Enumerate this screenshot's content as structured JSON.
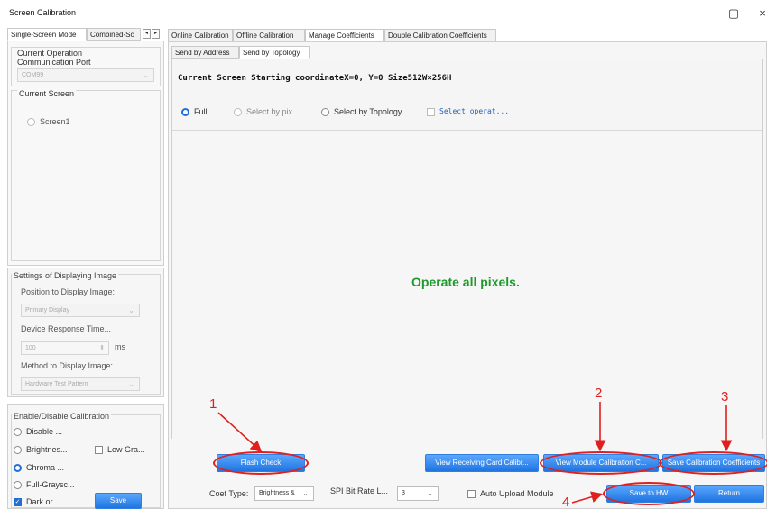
{
  "window": {
    "title": "Screen Calibration",
    "minimize_glyph": "–",
    "maximize_glyph": "▢",
    "close_glyph": "×"
  },
  "left_tabs": {
    "single": "Single-Screen Mode",
    "combined": "Combined-Sc",
    "arrow_left": "◂",
    "arrow_right": "▸"
  },
  "current_operation": {
    "legend": "Current Operation",
    "port_label": "Communication Port",
    "port_value": "COM99"
  },
  "current_screen": {
    "legend": "Current Screen",
    "screen_item": "Screen1"
  },
  "display_settings": {
    "legend": "Settings of Displaying Image",
    "position_label": "Position to Display Image:",
    "position_value": "Primary Display",
    "response_label": "Device Response Time...",
    "response_value": "100",
    "response_unit": "ms",
    "method_label": "Method to Display Image:",
    "method_value": "Hardware Test Pattern"
  },
  "enable_calibration": {
    "legend": "Enable/Disable Calibration",
    "disable": "Disable ...",
    "brightness": "Brightnes...",
    "low_gray": "Low Gra...",
    "chroma": "Chroma ...",
    "full_gray": "Full-Graysc...",
    "dark_or": "Dark or ...",
    "save": "Save"
  },
  "main_tabs": {
    "online": "Online Calibration",
    "offline": "Offline Calibration",
    "manage": "Manage Coefficients",
    "double": "Double Calibration Coefficients"
  },
  "sub_tabs": {
    "by_address": "Send by Address",
    "by_topology": "Send by Topology"
  },
  "screen_info": "Current Screen  Starting coordinateX=0, Y=0   Size512W×256H",
  "mode_options": {
    "full": "Full ...",
    "select_pixel": "Select by pix...",
    "select_topology": "Select by Topology ...",
    "select_operat": "Select operat..."
  },
  "canvas_message": "Operate all pixels.",
  "bottom_buttons": {
    "flash_check": "Flash Check",
    "view_receiving": "View Receiving Card Calibr...",
    "view_module": "View Module Calibration C...",
    "save_coeff": "Save Calibration Coefficients",
    "save_hw": "Save to HW",
    "return": "Return"
  },
  "coef_row": {
    "coef_type_label": "Coef Type:",
    "coef_type_value": "Brightness &",
    "spi_label": "SPI Bit Rate L...",
    "spi_value": "3",
    "auto_upload": "Auto Upload Module"
  },
  "annotations": [
    "1",
    "2",
    "3",
    "4"
  ],
  "colors": {
    "accent_blue": "#1f74e0",
    "canvas_green": "#1e9a2c",
    "annotation_red": "#e0201e"
  }
}
